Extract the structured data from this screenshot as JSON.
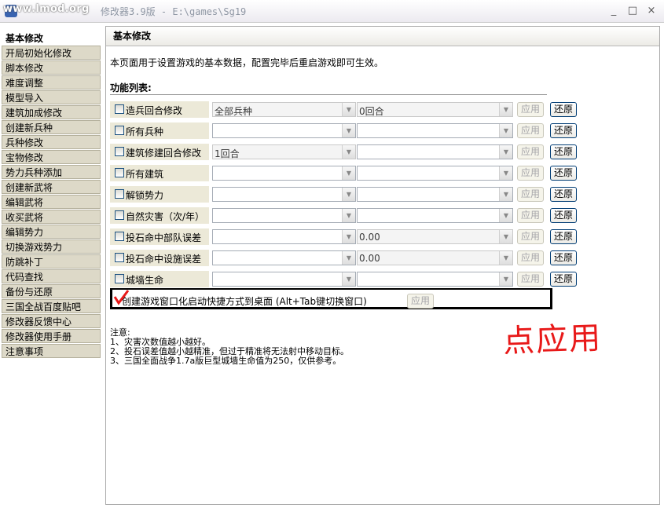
{
  "window": {
    "watermark": "www.lmod.org",
    "title": "修改器3.9版 - E:\\games\\Sg19",
    "controls": [
      "_",
      "□",
      "×"
    ]
  },
  "sidebar": {
    "items": [
      "基本修改",
      "开局初始化修改",
      "脚本修改",
      "难度调整",
      "模型导入",
      "建筑加成修改",
      "创建新兵种",
      "兵种修改",
      "宝物修改",
      "势力兵种添加",
      "创建新武将",
      "编辑武将",
      "收买武将",
      "编辑势力",
      "切换游戏势力",
      "防跳补丁",
      "代码查找",
      "备份与还原",
      "三国全战百度贴吧",
      "修改器反馈中心",
      "修改器使用手册",
      "注意事项"
    ],
    "active": "基本修改"
  },
  "panel": {
    "title": "基本修改",
    "description": "本页面用于设置游戏的基本数据，配置完毕后重启游戏即可生效。",
    "list_title": "功能列表:"
  },
  "rows": [
    {
      "label": "造兵回合修改",
      "combo1": "全部兵种",
      "combo2": "0回合",
      "apply": "应用",
      "restore": "还原"
    },
    {
      "label": "所有兵种",
      "combo1": "",
      "combo2": "",
      "apply": "应用",
      "restore": "还原"
    },
    {
      "label": "建筑修建回合修改",
      "combo1": "1回合",
      "combo2": "",
      "apply": "应用",
      "restore": "还原"
    },
    {
      "label": "所有建筑",
      "combo1": "",
      "combo2": "",
      "apply": "应用",
      "restore": "还原"
    },
    {
      "label": "解锁势力",
      "combo1": "",
      "combo2": "",
      "apply": "应用",
      "restore": "还原"
    },
    {
      "label": "自然灾害（次/年）",
      "combo1": "",
      "combo2": "",
      "apply": "应用",
      "restore": "还原"
    },
    {
      "label": "投石命中部队误差",
      "combo1": "",
      "combo2": "0.00",
      "apply": "应用",
      "restore": "还原"
    },
    {
      "label": "投石命中设施误差",
      "combo1": "",
      "combo2": "0.00",
      "apply": "应用",
      "restore": "还原"
    },
    {
      "label": "城墙生命",
      "combo1": "",
      "combo2": "",
      "apply": "应用",
      "restore": "还原"
    }
  ],
  "shortcut": {
    "label": "创建游戏窗口化启动快捷方式到桌面 (Alt+Tab键切换窗口)",
    "apply": "应用",
    "checked": true
  },
  "notes": {
    "title": "注意:",
    "lines": [
      "1、灾害次数值越小越好。",
      "2、投石误差值越小越精准，但过于精准将无法射中移动目标。",
      "3、三国全面战争1.7a版巨型城墙生命值为250，仅供参考。"
    ]
  },
  "annotation": {
    "text": "点应用",
    "color": "#e81919"
  },
  "colors": {
    "sidebar_item_bg": "#ddd9c8",
    "button_border": "#003c74",
    "annotation_red": "#e81919"
  }
}
